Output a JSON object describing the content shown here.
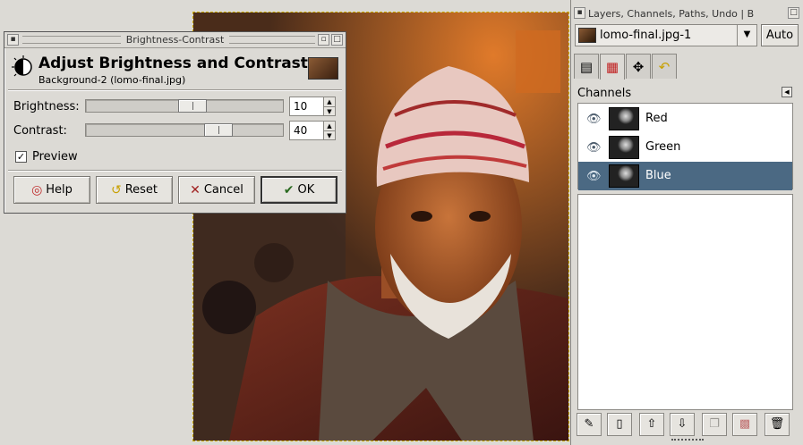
{
  "dialog": {
    "window_title": "Brightness-Contrast",
    "heading": "Adjust Brightness and Contrast",
    "subheading": "Background-2 (lomo-final.jpg)",
    "brightness": {
      "label": "Brightness:",
      "value": "10",
      "level_fraction": 0.55
    },
    "contrast": {
      "label": "Contrast:",
      "value": "40",
      "level_fraction": 0.7
    },
    "preview": {
      "label": "Preview",
      "checked": true
    },
    "buttons": {
      "help": "Help",
      "reset": "Reset",
      "cancel": "Cancel",
      "ok": "OK"
    }
  },
  "dock": {
    "window_title": "Layers, Channels, Paths, Undo | B",
    "image_combo": "lomo-final.jpg-1",
    "auto_label": "Auto",
    "panel_title": "Channels",
    "channels": [
      {
        "name": "Red",
        "selected": false
      },
      {
        "name": "Green",
        "selected": false
      },
      {
        "name": "Blue",
        "selected": true
      }
    ]
  },
  "colors": {
    "selection": "#4b6983",
    "window_bg": "#dcdad5"
  },
  "icons": {
    "tabs": [
      "layers-icon",
      "channels-icon",
      "paths-icon",
      "undo-icon"
    ],
    "bottom": [
      "edit-channel-icon",
      "new-channel-icon",
      "raise-icon",
      "lower-icon",
      "duplicate-icon",
      "to-selection-icon",
      "delete-icon"
    ]
  }
}
